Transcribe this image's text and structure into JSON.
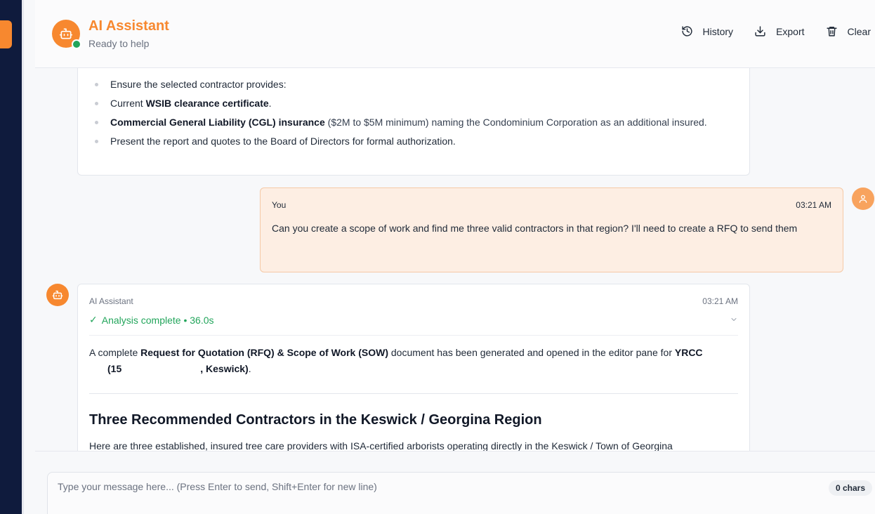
{
  "header": {
    "title": "AI Assistant",
    "subtitle": "Ready to help",
    "actions": {
      "history": "History",
      "export": "Export",
      "clear": "Clear"
    }
  },
  "prev_message": {
    "bullets": {
      "b1": "Ensure the selected contractor provides:",
      "b2_pre": "Current ",
      "b2_bold": "WSIB clearance certificate",
      "b2_post": ".",
      "b3_bold": "Commercial General Liability (CGL) insurance",
      "b3_post": " ($2M to $5M minimum) naming the Condominium Corporation as an additional insured.",
      "b4": "Present the report and quotes to the Board of Directors for formal authorization."
    }
  },
  "user_message": {
    "name": "You",
    "time": "03:21 AM",
    "text": "Can you create a scope of work and find me three valid contractors in that region? I'll need to create a RFQ to send them"
  },
  "ai_message": {
    "name": "AI Assistant",
    "time": "03:21 AM",
    "status_check": "✓",
    "status": "Analysis complete • 36.0s",
    "para_pre": "A complete ",
    "para_bold1": "Request for Quotation (RFQ) & Scope of Work (SOW)",
    "para_mid": " document has been generated and opened in the editor pane for ",
    "para_bold2": "YRCC",
    "para_bold3": "(15",
    "para_bold4": ", Keswick)",
    "para_end": ".",
    "heading": "Three Recommended Contractors in the Keswick / Georgina Region",
    "section_text": "Here are three established, insured tree care providers with ISA-certified arborists operating directly in the Keswick / Town of Georgina"
  },
  "composer": {
    "placeholder": "Type your message here... (Press Enter to send, Shift+Enter for new line)",
    "char_count": "0 chars"
  },
  "colors": {
    "accent": "#f7882f",
    "online": "#22a55b",
    "rail": "#0f1b3d",
    "user_bubble": "#fdeee3"
  }
}
